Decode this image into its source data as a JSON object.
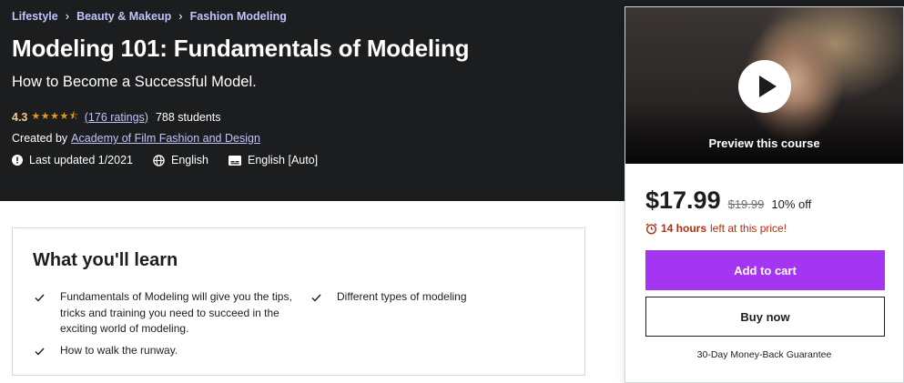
{
  "breadcrumb": {
    "items": [
      "Lifestyle",
      "Beauty & Makeup",
      "Fashion Modeling"
    ]
  },
  "course": {
    "title": "Modeling 101: Fundamentals of Modeling",
    "subtitle": "How to Become a Successful Model.",
    "rating_value": "4.3",
    "rating_stars": 4.3,
    "ratings_count": "(176 ratings)",
    "students": "788 students",
    "created_by_label": "Created by",
    "author": "Academy of Film Fashion and Design",
    "last_updated": "Last updated 1/2021",
    "language": "English",
    "captions": "English [Auto]"
  },
  "card": {
    "preview_label": "Preview this course",
    "price": "$17.99",
    "original_price": "$19.99",
    "discount": "10% off",
    "timer_bold": "14 hours",
    "timer_rest": "left at this price!",
    "add_to_cart": "Add to cart",
    "buy_now": "Buy now",
    "guarantee": "30-Day Money-Back Guarantee"
  },
  "learn": {
    "title": "What you'll learn",
    "items": [
      "Fundamentals of Modeling will give you the tips, tricks and training you need to succeed in the exciting world of modeling.",
      "Different types of modeling",
      "How to walk the runway."
    ]
  },
  "colors": {
    "hero_bg": "#1c1d1f",
    "link_purple": "#c0c4fc",
    "rating_gold": "#f3ca8c",
    "accent_purple": "#a435f0",
    "timer_red": "#b32d0f"
  },
  "icons": [
    "chevron-right-icon",
    "star-icon",
    "alert-icon",
    "globe-icon",
    "captions-icon",
    "play-icon",
    "alarm-clock-icon",
    "check-icon"
  ]
}
